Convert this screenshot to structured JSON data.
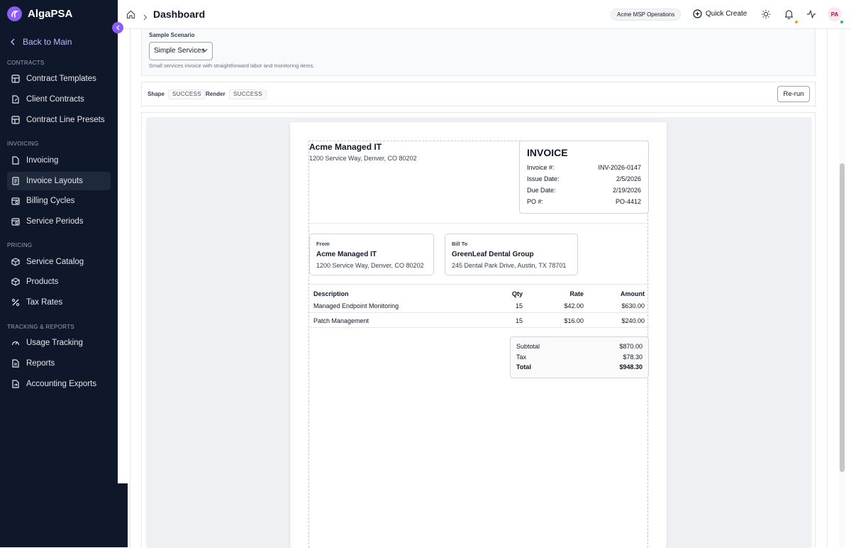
{
  "app": {
    "name": "AlgaPSA"
  },
  "sidebar": {
    "back_label": "Back to Main",
    "sections": {
      "contracts": "CONTRACTS",
      "invoicing": "INVOICING",
      "pricing": "PRICING",
      "tracking": "TRACKING & REPORTS"
    },
    "items": {
      "contract_templates": "Contract Templates",
      "client_contracts": "Client Contracts",
      "contract_line_presets": "Contract Line Presets",
      "invoicing": "Invoicing",
      "invoice_layouts": "Invoice Layouts",
      "billing_cycles": "Billing Cycles",
      "service_periods": "Service Periods",
      "service_catalog": "Service Catalog",
      "products": "Products",
      "tax_rates": "Tax Rates",
      "usage_tracking": "Usage Tracking",
      "reports": "Reports",
      "accounting_exports": "Accounting Exports"
    },
    "active_item": "Invoice Layouts"
  },
  "topbar": {
    "title": "Dashboard",
    "tenant": "Acme MSP Operations",
    "quick_create": "Quick Create",
    "avatar_initials": "PA",
    "colors": {
      "notification_dot": "#f59e0b",
      "status_dot": "#22c55e"
    }
  },
  "scenario": {
    "label": "Sample Scenario",
    "selected": "Simple Services",
    "description": "Small services invoice with straightforward labor and monitoring items."
  },
  "status": {
    "shape_label": "Shape",
    "shape_value": "SUCCESS",
    "render_label": "Render",
    "render_value": "SUCCESS",
    "rerun_label": "Re-run"
  },
  "invoice": {
    "company_name": "Acme Managed IT",
    "company_address": "1200 Service Way, Denver, CO 80202",
    "title": "INVOICE",
    "meta": [
      {
        "label": "Invoice #:",
        "value": "INV-2026-0147"
      },
      {
        "label": "Issue Date:",
        "value": "2/5/2026"
      },
      {
        "label": "Due Date:",
        "value": "2/19/2026"
      },
      {
        "label": "PO #:",
        "value": "PO-4412"
      }
    ],
    "from": {
      "label": "From",
      "name": "Acme Managed IT",
      "address": "1200 Service Way, Denver, CO 80202"
    },
    "bill_to": {
      "label": "Bill To",
      "name": "GreenLeaf Dental Group",
      "address": "245 Dental Park Drive, Austin, TX 78701"
    },
    "columns": {
      "description": "Description",
      "qty": "Qty",
      "rate": "Rate",
      "amount": "Amount"
    },
    "lines": [
      {
        "description": "Managed Endpoint Monitoring",
        "qty": "15",
        "rate": "$42.00",
        "amount": "$630.00"
      },
      {
        "description": "Patch Management",
        "qty": "15",
        "rate": "$16.00",
        "amount": "$240.00"
      }
    ],
    "totals": [
      {
        "label": "Subtotal",
        "value": "$870.00"
      },
      {
        "label": "Tax",
        "value": "$78.30"
      },
      {
        "label": "Total",
        "value": "$948.30"
      }
    ]
  },
  "colors": {
    "sidebar_bg": "#0f172a",
    "accent": "#8b5cf6",
    "back_link": "#c4b5fd"
  }
}
